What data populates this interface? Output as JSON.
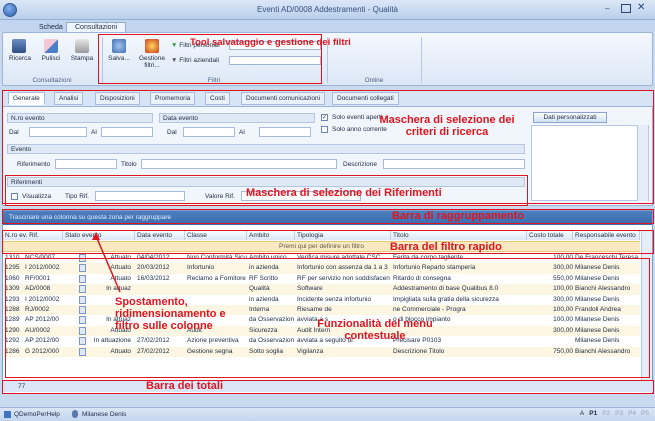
{
  "window": {
    "title": "Eventi AD/0008 Addestramenti - Qualità"
  },
  "ribbon_tabs": [
    "Scheda",
    "Consultazioni"
  ],
  "ribbon": {
    "buttons": [
      "Ricerca",
      "Pulisci",
      "Stampa",
      "Salva...",
      "Gestione filtri..."
    ],
    "filters": [
      "Filtri personali",
      "Filtri aziendali"
    ],
    "groups": [
      "Consultazioni",
      "Filtri",
      "Online"
    ]
  },
  "panel_tabs": [
    "Generale",
    "Analisi",
    "Disposizioni",
    "Promemoria",
    "Costi",
    "Documenti comunicazioni",
    "Documenti collegati"
  ],
  "form": {
    "nro_evento": "N.ro evento",
    "data_evento": "Data evento",
    "dal": "Dal",
    "al": "Al",
    "solo_aperti": "Solo eventi aperti",
    "solo_anno": "Solo anno corrente",
    "evento": "Evento",
    "riferimento": "Riferimento",
    "titolo": "Titolo",
    "descrizione": "Descrizione",
    "riferimenti": "Riferimenti",
    "visualizza": "Visualizza",
    "tipo_rif": "Tipo Rif.",
    "valore_rif": "Valore Rif.",
    "dati_personalizzati": "Dati personalizzati"
  },
  "grid": {
    "group_hint": "Trascinare una colonna su questa zona per raggruppare",
    "filter_hint": "Premi qui per definire un filtro",
    "headers": [
      "N.ro ev. Rif.",
      "Stato evento",
      "Data evento",
      "Classe",
      "Ambito",
      "Tipologia",
      "Titolo",
      "Costo totale",
      "Responsabile evento"
    ],
    "rows": [
      {
        "nro": "1310",
        "rif": "NCS/0007",
        "stato": "Attuato",
        "data": "04/04/2012",
        "classe": "Non Conformità Sicur",
        "ambito": "Ambito unico",
        "tipologia": "Verifica misure adottate CSC",
        "titolo": "Ferita da corpo tagliente",
        "costo": "100,00",
        "resp": "De Franceschi Teresa"
      },
      {
        "nro": "1295",
        "rif": "I 2012/0002",
        "stato": "Attuato",
        "data": "20/03/2012",
        "classe": "Infortunio",
        "ambito": "in azienda",
        "tipologia": "Infortunio con assenza da 1 a 3",
        "titolo": "Infortunio Reparto stamperia",
        "costo": "300,00",
        "resp": "Milanese Denis"
      },
      {
        "nro": "1060",
        "rif": "RF/0001",
        "stato": "Attuato",
        "data": "16/03/2012",
        "classe": "Reclamo a Fornitore",
        "ambito": "RF Scritto",
        "tipologia": "RF per servizio non soddisfacen",
        "titolo": "Ritardo di consegna",
        "costo": "550,00",
        "resp": "Milanese Denis"
      },
      {
        "nro": "1309",
        "rif": "AD/0008",
        "stato": "In attuaz",
        "data": "",
        "classe": "",
        "ambito": "Qualità",
        "tipologia": "Software",
        "titolo": "Addestramento di base Qualibus 8.0",
        "costo": "100,00",
        "resp": "Bianchi Alessandro"
      },
      {
        "nro": "1293",
        "rif": "I 2012/0002",
        "stato": "",
        "data": "",
        "classe": "",
        "ambito": "in azienda",
        "tipologia": "Incidente senza infortunio",
        "titolo": "Impigliata sulla gratia della sicurezza",
        "costo": "300,00",
        "resp": "Milanese Denis"
      },
      {
        "nro": "1288",
        "rif": "RJ/0002",
        "stato": "",
        "data": "",
        "classe": "",
        "ambito": "Interna",
        "tipologia": "Riesame de",
        "titolo": "ne Commerciale - Progra",
        "costo": "100,00",
        "resp": "Frandoli Andrea"
      },
      {
        "nro": "1289",
        "rif": "AP 2012/00",
        "stato": "In attuaz",
        "data": "",
        "classe": "",
        "ambito": "da Osservazion",
        "tipologia": "avviata a s",
        "titolo": "o di blocco impianto",
        "costo": "100,00",
        "resp": "Milanese Denis"
      },
      {
        "nro": "1290",
        "rif": "AU/0002",
        "stato": "Attuato",
        "data": "",
        "classe": "Audit",
        "ambito": "Sicurezza",
        "tipologia": "Audit Intern",
        "titolo": "",
        "costo": "300,00",
        "resp": "Milanese Denis"
      },
      {
        "nro": "1292",
        "rif": "AP 2012/00",
        "stato": "In attuazione",
        "data": "27/02/2012",
        "classe": "Azione preventiva",
        "ambito": "da Osservazion",
        "tipologia": "avviata a seguito di",
        "titolo": "Precisare P0103",
        "costo": "",
        "resp": "Milanese Denis"
      },
      {
        "nro": "1286",
        "rif": "G 2012/000",
        "stato": "Attuato",
        "data": "27/02/2012",
        "classe": "Gestione segna",
        "ambito": "Sotto soglia",
        "tipologia": "Vigilanza",
        "titolo": "Descrizione Titolo",
        "costo": "750,00",
        "resp": "Bianchi Alessandro"
      }
    ],
    "total_count": "77"
  },
  "status": {
    "help": "QDemoPerHelp",
    "user": "Milanese Denis",
    "pages": [
      "A",
      "P1",
      "P2",
      "P3",
      "P4",
      "P5"
    ]
  },
  "annotations": {
    "tool": "Tool salvataggio e gestione dei filtri",
    "mask": "Maschera di selezione dei criteri di ricerca",
    "rif": "Maschera di selezione dei Riferimenti",
    "group": "Barra di raggruppamento",
    "filter": "Barra del filtro rapido",
    "move": "Spostamento, ridimensionamento e filtro sulle colonne",
    "ctx": "Funzionalità del menu contestuale",
    "totals": "Barra dei totali"
  },
  "colors": {
    "accent": "#e0141e",
    "ribbon": "#dce7f6",
    "group_bar": "#3c6bae",
    "row_alt": "#fdf6e3"
  }
}
